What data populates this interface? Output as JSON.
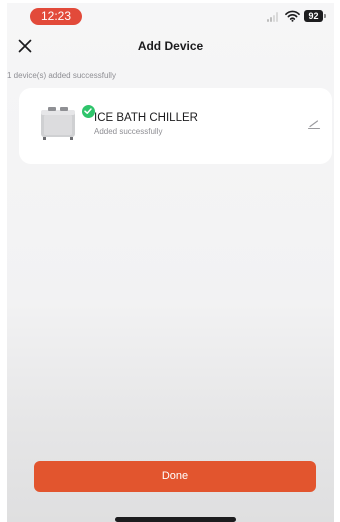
{
  "status_bar": {
    "time": "12:23",
    "battery_level": "92",
    "signal_icon": "cellular-signal-icon",
    "wifi_icon": "wifi-icon",
    "battery_icon": "battery-icon"
  },
  "nav": {
    "title": "Add Device",
    "close_icon": "close-icon"
  },
  "status_message": "1 device(s) added successfully",
  "devices": [
    {
      "name": "ICE BATH CHILLER",
      "status": "Added successfully",
      "image_icon": "chiller-device-icon",
      "badge_icon": "checkmark-icon",
      "edit_icon": "edit-icon"
    }
  ],
  "done_button": {
    "label": "Done"
  },
  "colors": {
    "accent": "#e2552e",
    "success": "#2fc46b",
    "time_pill": "#e24a3a"
  }
}
